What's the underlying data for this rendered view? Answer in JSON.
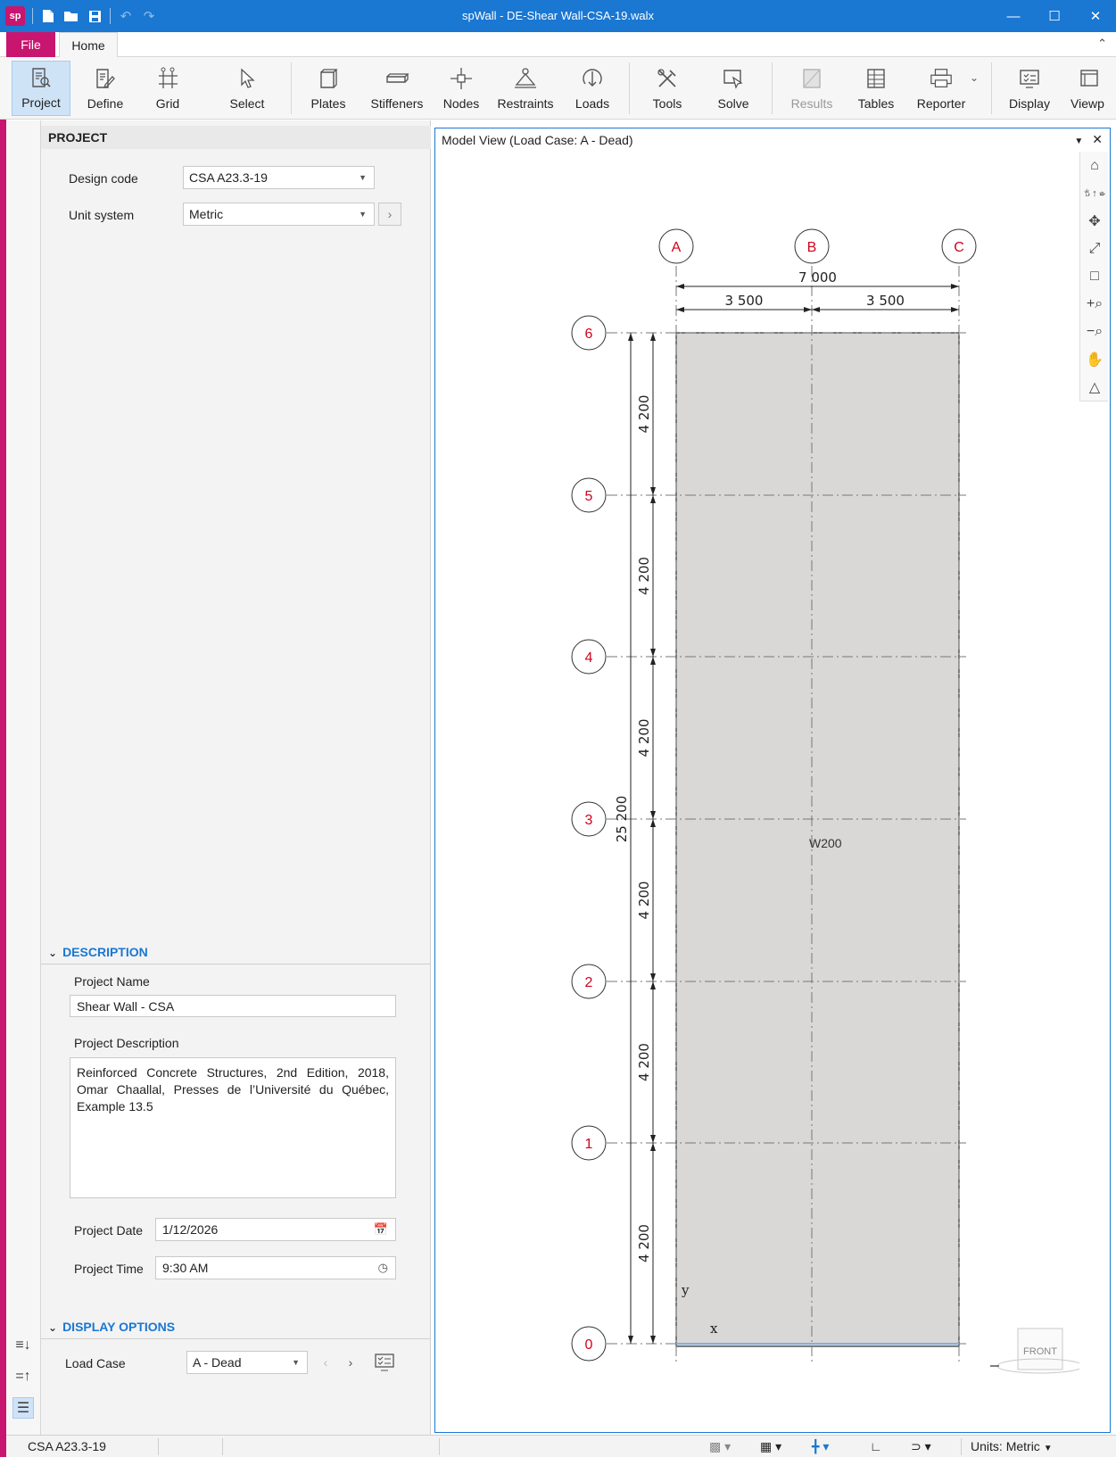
{
  "window": {
    "title": "spWall - DE-Shear Wall-CSA-19.walx",
    "logo": "sp"
  },
  "tabs": {
    "file": "File",
    "home": "Home"
  },
  "ribbon": [
    {
      "label": "Project",
      "icon": "project-icon",
      "active": true
    },
    {
      "label": "Define",
      "icon": "define-icon"
    },
    {
      "label": "Grid",
      "icon": "grid-icon"
    },
    {
      "label": "Select",
      "icon": "cursor-icon"
    },
    {
      "label": "Plates",
      "icon": "plates-icon"
    },
    {
      "label": "Stiffeners",
      "icon": "stiffeners-icon"
    },
    {
      "label": "Nodes",
      "icon": "nodes-icon"
    },
    {
      "label": "Restraints",
      "icon": "restraints-icon"
    },
    {
      "label": "Loads",
      "icon": "loads-icon"
    },
    {
      "label": "Tools",
      "icon": "tools-icon"
    },
    {
      "label": "Solve",
      "icon": "solve-icon"
    },
    {
      "label": "Results",
      "icon": "results-icon",
      "disabled": true
    },
    {
      "label": "Tables",
      "icon": "tables-icon"
    },
    {
      "label": "Reporter",
      "icon": "printer-icon"
    },
    {
      "label": "Display",
      "icon": "display-icon"
    },
    {
      "label": "Viewp",
      "icon": "viewport-icon"
    }
  ],
  "panel": {
    "header": "PROJECT",
    "design_code_label": "Design code",
    "design_code_value": "CSA A23.3-19",
    "unit_system_label": "Unit system",
    "unit_system_value": "Metric",
    "description_header": "DESCRIPTION",
    "project_name_label": "Project Name",
    "project_name_value": "Shear Wall - CSA",
    "project_desc_label": "Project Description",
    "project_desc_value": "Reinforced Concrete Structures, 2nd Edition, 2018, Omar Chaallal, Presses de l’Université du Québec, Example 13.5",
    "project_date_label": "Project Date",
    "project_date_value": "1/12/2026",
    "project_time_label": "Project Time",
    "project_time_value": "9:30 AM",
    "display_options_header": "DISPLAY OPTIONS",
    "load_case_label": "Load Case",
    "load_case_value": "A - Dead"
  },
  "model_view": {
    "title": "Model View (Load Case: A - Dead)",
    "grid_x": [
      "A",
      "B",
      "C"
    ],
    "grid_y": [
      "6",
      "5",
      "4",
      "3",
      "2",
      "1",
      "0"
    ],
    "total_width": "7 000",
    "bay_widths": [
      "3 500",
      "3 500"
    ],
    "story_heights": [
      "4 200",
      "4 200",
      "4 200",
      "4 200",
      "4 200",
      "4 200"
    ],
    "total_height": "25 200",
    "wall_label": "W200",
    "axis_y": "y",
    "axis_x": "x",
    "view_cube": "FRONT",
    "fill_color": "#d9d8d7",
    "grid_color": "#d0021b"
  },
  "status": {
    "code": "CSA A23.3-19",
    "units_label": "Units:",
    "units_value": "Metric"
  },
  "colors": {
    "accent": "#1a77d2",
    "brand": "#c8156f"
  }
}
